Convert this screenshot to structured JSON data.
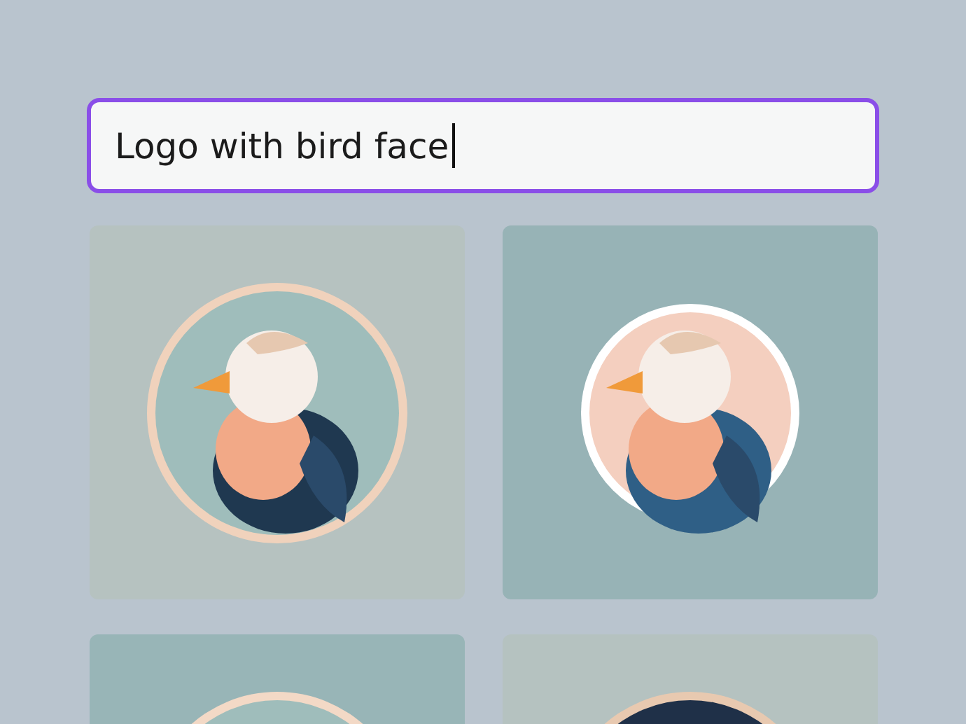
{
  "search": {
    "value": "Logo with bird face"
  }
}
